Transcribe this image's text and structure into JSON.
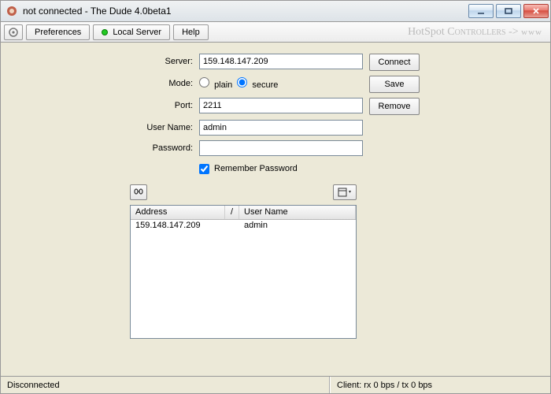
{
  "window": {
    "title": "not connected - The Dude 4.0beta1"
  },
  "toolbar": {
    "preferences": "Preferences",
    "localServer": "Local Server",
    "help": "Help",
    "hotspot_prefix": "HotSpot",
    "hotspot_suffix": " Controllers",
    "hotspot_arrow": "->",
    "hotspot_www": "www"
  },
  "form": {
    "serverLabel": "Server:",
    "serverValue": "159.148.147.209",
    "modeLabel": "Mode:",
    "modePlain": "plain",
    "modeSecure": "secure",
    "modeSelected": "secure",
    "portLabel": "Port:",
    "portValue": "2211",
    "userLabel": "User Name:",
    "userValue": "admin",
    "passLabel": "Password:",
    "passValue": "",
    "rememberLabel": "Remember Password",
    "rememberChecked": true
  },
  "buttons": {
    "connect": "Connect",
    "save": "Save",
    "remove": "Remove"
  },
  "table": {
    "colAddress": "Address",
    "sortGlyph": "/",
    "colUser": "User Name",
    "rows": [
      {
        "address": "159.148.147.209",
        "user": "admin"
      }
    ]
  },
  "status": {
    "left": "Disconnected",
    "right": "Client: rx 0 bps / tx 0 bps"
  }
}
